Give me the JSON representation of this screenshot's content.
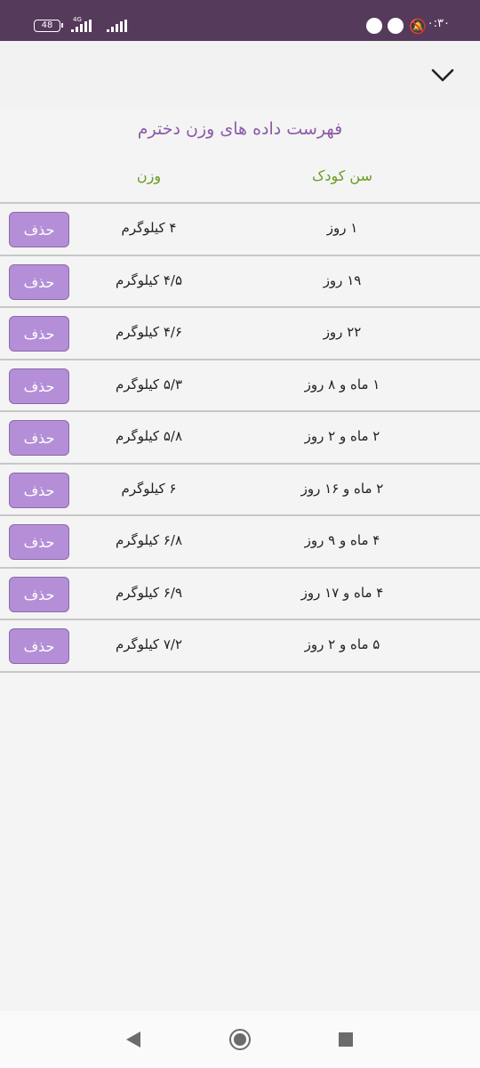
{
  "status_bar": {
    "battery": "48",
    "network": "4G",
    "time": "۰:۳۰"
  },
  "header": {
    "collapse_icon": "chevron-down-icon"
  },
  "page": {
    "title": "فهرست داده های وزن دخترم"
  },
  "table": {
    "columns": {
      "age": "سن کودک",
      "weight": "وزن"
    },
    "delete_label": "حذف",
    "rows": [
      {
        "age": "۱ روز",
        "weight": "۴ کیلوگرم"
      },
      {
        "age": "۱۹ روز",
        "weight": "۴/۵ کیلوگرم"
      },
      {
        "age": "۲۲ روز",
        "weight": "۴/۶ کیلوگرم"
      },
      {
        "age": "۱ ماه و ۸ روز",
        "weight": "۵/۳ کیلوگرم"
      },
      {
        "age": "۲ ماه و ۲ روز",
        "weight": "۵/۸ کیلوگرم"
      },
      {
        "age": "۲ ماه و ۱۶ روز",
        "weight": "۶ کیلوگرم"
      },
      {
        "age": "۴ ماه و ۹ روز",
        "weight": "۶/۸ کیلوگرم"
      },
      {
        "age": "۴ ماه و ۱۷ روز",
        "weight": "۶/۹ کیلوگرم"
      },
      {
        "age": "۵ ماه و ۲ روز",
        "weight": "۷/۲ کیلوگرم"
      }
    ]
  },
  "colors": {
    "status_bar": "#553a5c",
    "title": "#8c5aa8",
    "column_header": "#6a9a22",
    "delete_button": "#b48fd8"
  }
}
